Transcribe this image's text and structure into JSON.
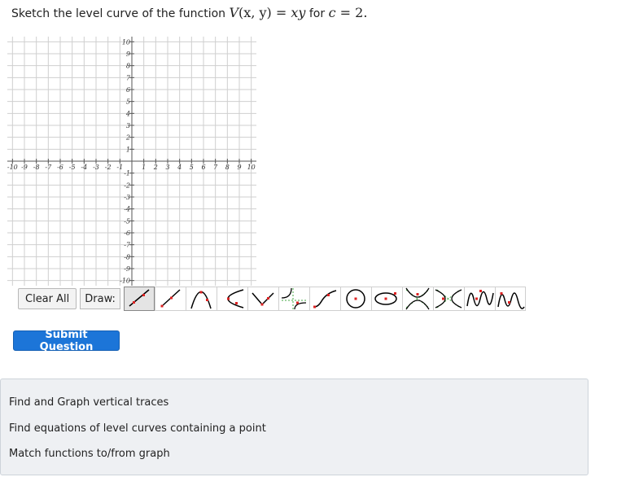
{
  "question": {
    "prefix": "Sketch the level curve of the function",
    "func_name": "V",
    "func_args": "(x, y)",
    "equals": "=",
    "func_expr": "xy",
    "for_text": "for",
    "c_var": "c",
    "c_eq": "=",
    "c_value": "2."
  },
  "graph": {
    "x_range": [
      -10,
      10
    ],
    "y_range": [
      -10,
      10
    ],
    "x_tick_labels": [
      "-10",
      "-9",
      "-8",
      "-7",
      "-6",
      "-5",
      "-4",
      "-3",
      "-2",
      "-1",
      "1",
      "2",
      "3",
      "4",
      "5",
      "6",
      "7",
      "8",
      "9",
      "10"
    ],
    "y_tick_labels": [
      "10",
      "9",
      "8",
      "7",
      "6",
      "5",
      "4",
      "3",
      "2",
      "1",
      "-1",
      "-2",
      "-3",
      "-4",
      "-5",
      "-6",
      "-7",
      "-8",
      "-9",
      "-10"
    ]
  },
  "toolbar": {
    "clear_label": "Clear All",
    "draw_label": "Draw:",
    "tools": [
      {
        "name": "line-tool-icon",
        "selected": true
      },
      {
        "name": "ray-tool-icon",
        "selected": false
      },
      {
        "name": "parabola-up-tool-icon",
        "selected": false
      },
      {
        "name": "horizontal-parabola-tool-icon",
        "selected": false
      },
      {
        "name": "absolute-value-tool-icon",
        "selected": false
      },
      {
        "name": "rational-tool-icon",
        "selected": false
      },
      {
        "name": "square-root-tool-icon",
        "selected": false
      },
      {
        "name": "circle-tool-icon",
        "selected": false
      },
      {
        "name": "ellipse-tool-icon",
        "selected": false
      },
      {
        "name": "vertical-hyperbola-tool-icon",
        "selected": false
      },
      {
        "name": "horizontal-hyperbola-tool-icon",
        "selected": false
      },
      {
        "name": "sine-tool-icon",
        "selected": false
      },
      {
        "name": "cosine-tool-icon",
        "selected": false
      }
    ]
  },
  "submit_label": "Submit Question",
  "related_links": [
    "Find and Graph vertical traces",
    "Find equations of level curves containing a point",
    "Match functions to/from graph"
  ]
}
